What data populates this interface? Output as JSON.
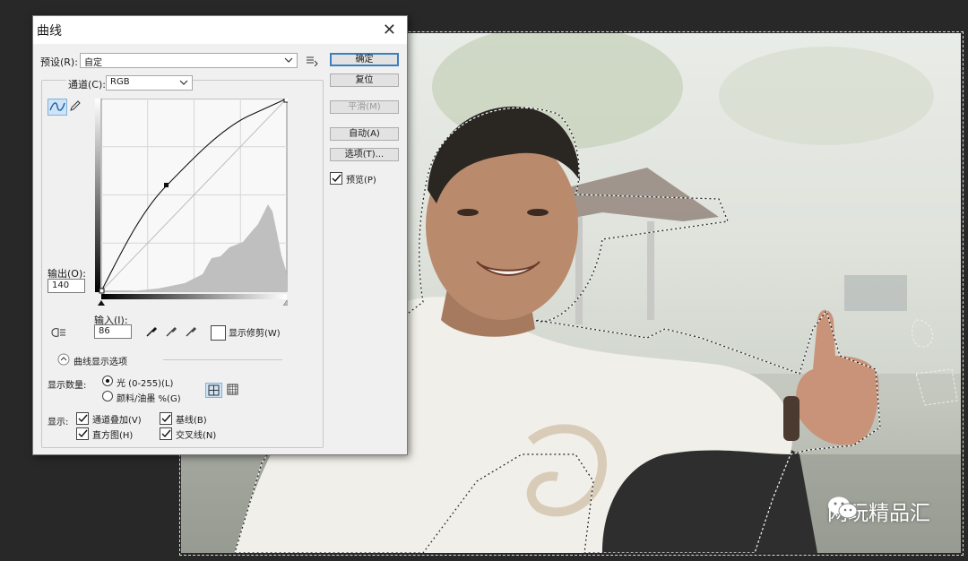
{
  "dialog": {
    "title": "曲线",
    "preset_label": "预设(R):",
    "preset_value": "自定",
    "channel_label": "通道(C):",
    "channel_value": "RGB",
    "output_label": "输出(O):",
    "output_value": "140",
    "input_label": "输入(I):",
    "input_value": "86",
    "show_clipping_label": "显示修剪(W)",
    "curve_display_options": "曲线显示选项",
    "show_amount_label": "显示数量:",
    "light_option": "光 (0-255)(L)",
    "pigment_option": "颜料/油墨 %(G)",
    "show_label": "显示:",
    "channel_overlays": "通道叠加(V)",
    "baseline": "基线(B)",
    "histogram": "直方图(H)",
    "intersection_line": "交叉线(N)",
    "preview_label": "预览(P)"
  },
  "buttons": {
    "ok": "确定",
    "reset": "复位",
    "smooth": "平滑(M)",
    "auto": "自动(A)",
    "options": "选项(T)..."
  },
  "state": {
    "preview_checked": true,
    "clipping_checked": false,
    "light_selected": true,
    "channel_overlays_checked": true,
    "baseline_checked": true,
    "histogram_checked": true,
    "intersection_checked": true
  },
  "watermark": {
    "text": "网玩精品汇"
  },
  "colors": {
    "primary_button_border": "#3c7fc1",
    "grid_toggle_active": "#cfe3f6",
    "canvas_bg": "#282828"
  }
}
